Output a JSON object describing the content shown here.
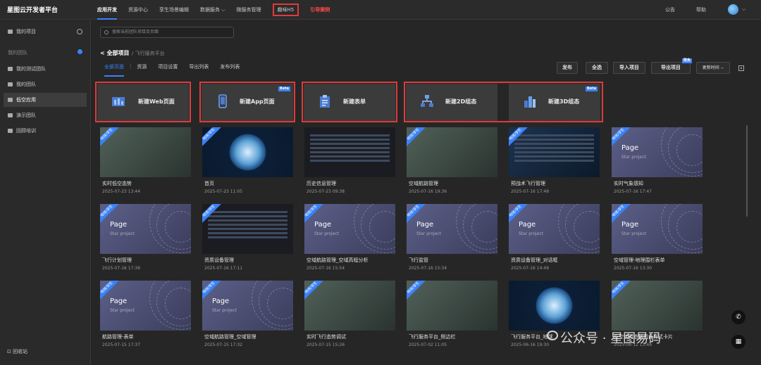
{
  "app": {
    "title": "星图云开发者平台"
  },
  "nav": {
    "items": [
      {
        "label": "应用开发"
      },
      {
        "label": "资源中心"
      },
      {
        "label": "孪生场景编辑"
      },
      {
        "label": "数据服务 ⌵"
      },
      {
        "label": "微服务管理"
      },
      {
        "label": "趣味H5"
      },
      {
        "label": "引导案例"
      }
    ],
    "notice": "公告",
    "help": "帮助"
  },
  "sidebar": {
    "my_project": "我的项目",
    "section": "我的团队",
    "items": [
      {
        "label": "我的测试团队"
      },
      {
        "label": "我的团队"
      },
      {
        "label": "低空应用"
      },
      {
        "label": "演示团队"
      },
      {
        "label": "回顾培训"
      }
    ],
    "footer": "回收站"
  },
  "search": {
    "placeholder": "搜索当前团队项目及页面"
  },
  "breadcrumb": {
    "back": "< 全部项目",
    "current": "/ 飞行服务平台"
  },
  "tabs": [
    {
      "label": "全部页面"
    },
    {
      "label": "资源"
    },
    {
      "label": "项目设置"
    },
    {
      "label": "导出列表"
    },
    {
      "label": "发布列表"
    }
  ],
  "toolbar": {
    "publish": "发布",
    "select_all": "全选",
    "import": "导入项目",
    "export": "导出项目",
    "export_badge": "限免",
    "sort": "更新时间 ⌵"
  },
  "create": {
    "web": "新建Web页面",
    "app": "新建App页面",
    "form": "新建表单",
    "d2": "新建2D组态",
    "d3": "新建3D组态",
    "beta": "Beta"
  },
  "ribbon": "地球/孪生",
  "placeholder": {
    "title": "Page",
    "sub": "Star project"
  },
  "cards": [
    {
      "name": "实时低空态势",
      "date": "2025-07-23 13:44",
      "style": "map",
      "ribbon": true
    },
    {
      "name": "首页",
      "date": "2025-07-23 11:05",
      "style": "globe",
      "ribbon": true
    },
    {
      "name": "历史信息管理",
      "date": "2025-07-23 09:38",
      "style": "table",
      "ribbon": false
    },
    {
      "name": "空域航路管理",
      "date": "2025-07-16 19:36",
      "style": "map",
      "ribbon": true
    },
    {
      "name": "预战术飞行管理",
      "date": "2025-07-16 17:48",
      "style": "dash",
      "ribbon": true
    },
    {
      "name": "实时气象感知",
      "date": "2025-07-16 17:47",
      "style": "page",
      "ribbon": true
    },
    {
      "name": "飞行计划管理",
      "date": "2025-07-16 17:36",
      "style": "page",
      "ribbon": true
    },
    {
      "name": "资质设备管理",
      "date": "2025-07-16 17:11",
      "style": "table",
      "ribbon": true
    },
    {
      "name": "空域航路管理_空域高程分析",
      "date": "2025-07-16 15:54",
      "style": "page",
      "ribbon": true
    },
    {
      "name": "飞行监管",
      "date": "2025-07-16 15:34",
      "style": "page",
      "ribbon": true
    },
    {
      "name": "资质设备管理_对话框",
      "date": "2025-07-16 14:49",
      "style": "page",
      "ribbon": true
    },
    {
      "name": "空域管理-地理围栏表单",
      "date": "2025-07-16 13:30",
      "style": "page",
      "ribbon": true
    },
    {
      "name": "航路管理-表单",
      "date": "2025-07-15 17:37",
      "style": "page",
      "ribbon": true
    },
    {
      "name": "空域航路管理_空域管理",
      "date": "2025-07-15 17:32",
      "style": "page",
      "ribbon": true
    },
    {
      "name": "实时飞行态势调试",
      "date": "2025-07-15 15:26",
      "style": "map",
      "ribbon": true
    },
    {
      "name": "飞行服务平台_侧边栏",
      "date": "2025-07-02 11:05",
      "style": "map",
      "ribbon": true
    },
    {
      "name": "飞行服务平台_地球",
      "date": "2025-06-16 19:30",
      "style": "globe",
      "ribbon": false
    },
    {
      "name": "低空实时态势组件样式卡片",
      "date": "2025-06-12 13:46",
      "style": "map",
      "ribbon": true
    }
  ],
  "watermark": "公众号 · 星图易码",
  "colors": {
    "accent": "#3b82f6",
    "highlight": "#e03a3a",
    "background": "#262626"
  }
}
